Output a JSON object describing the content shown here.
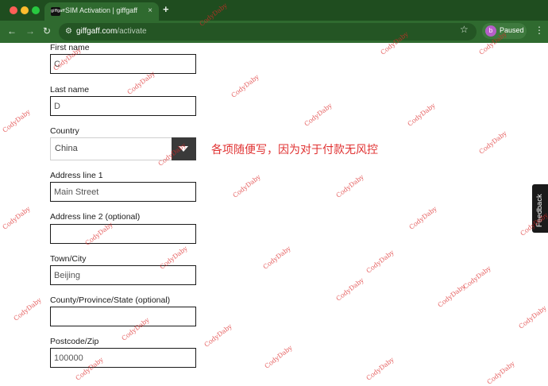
{
  "browser": {
    "tab_title": "SIM Activation | giffgaff",
    "tab_favicon_text": "giffgaff",
    "new_tab": "+",
    "tab_close": "×",
    "url_domain": "giffgaff.com",
    "url_path": "/activate",
    "profile_initial": "b",
    "profile_label": "Paused",
    "accent_color": "#1f4d1f"
  },
  "form": {
    "first_name": {
      "label": "First name",
      "value": "C"
    },
    "last_name": {
      "label": "Last name",
      "value": "D"
    },
    "country": {
      "label": "Country",
      "value": "China"
    },
    "address1": {
      "label": "Address line 1",
      "value": "Main Street"
    },
    "address2": {
      "label": "Address line 2 (optional)",
      "value": ""
    },
    "town": {
      "label": "Town/City",
      "value": "Beijing"
    },
    "county": {
      "label": "County/Province/State (optional)",
      "value": ""
    },
    "postcode": {
      "label": "Postcode/Zip",
      "value": "100000"
    }
  },
  "annotation": "各项随便写，因为对于付款无风控",
  "feedback_label": "Feedback",
  "watermark": "CodyDaby"
}
